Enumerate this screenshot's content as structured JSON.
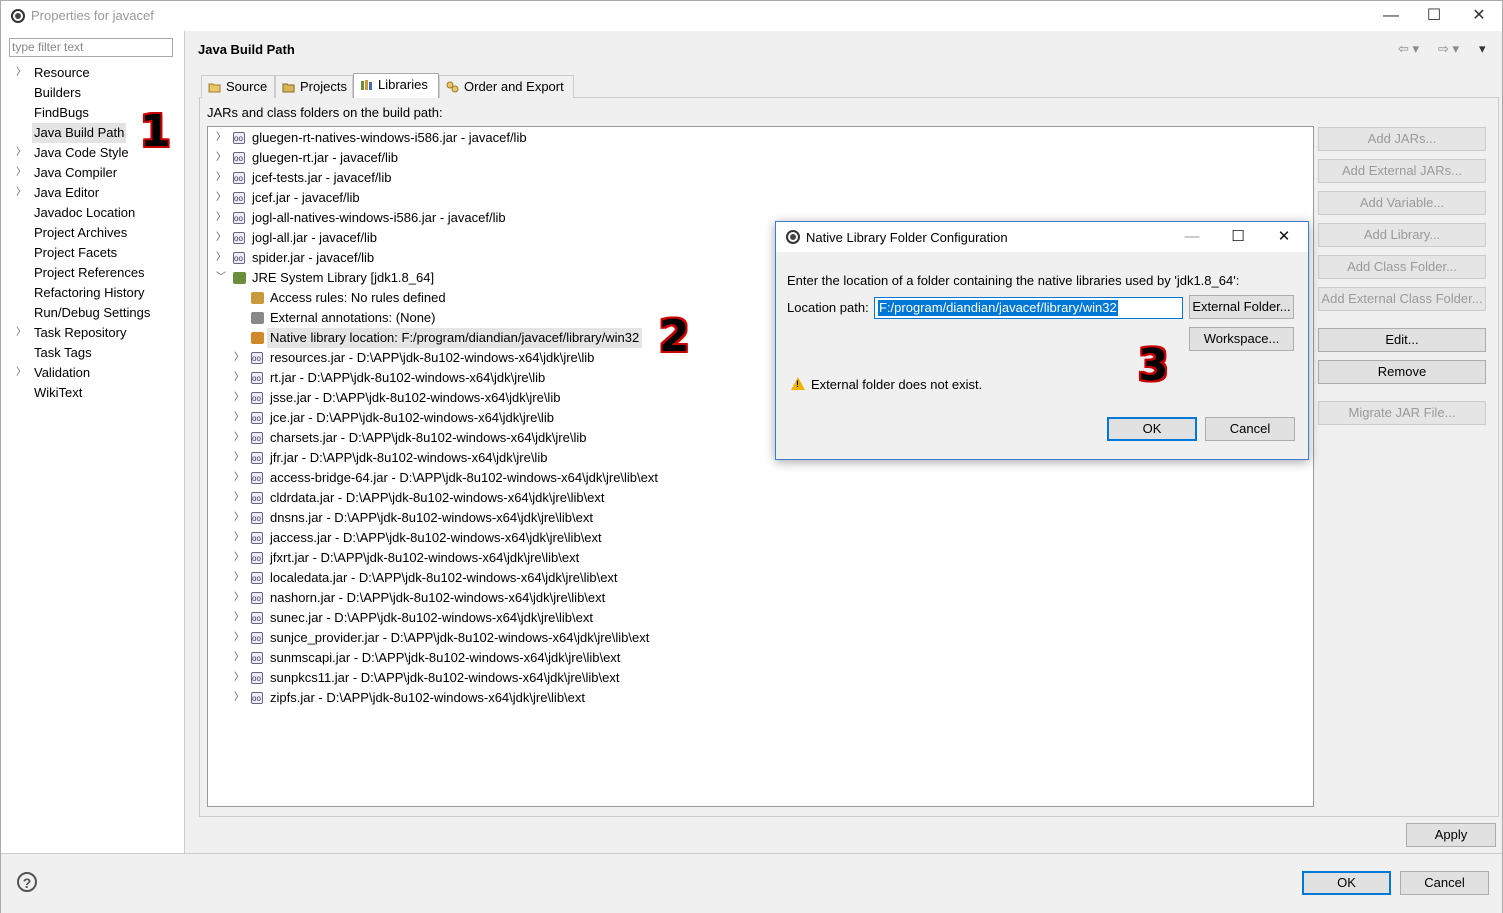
{
  "window": {
    "title": "Properties for javacef",
    "controls": [
      "—",
      "☐",
      "✕"
    ]
  },
  "filter": {
    "placeholder": "type filter text"
  },
  "nav": {
    "items": [
      {
        "label": "Resource",
        "expandable": true
      },
      {
        "label": "Builders",
        "expandable": false
      },
      {
        "label": "FindBugs",
        "expandable": false
      },
      {
        "label": "Java Build Path",
        "expandable": false,
        "selected": true
      },
      {
        "label": "Java Code Style",
        "expandable": true
      },
      {
        "label": "Java Compiler",
        "expandable": true
      },
      {
        "label": "Java Editor",
        "expandable": true
      },
      {
        "label": "Javadoc Location",
        "expandable": false
      },
      {
        "label": "Project Archives",
        "expandable": false
      },
      {
        "label": "Project Facets",
        "expandable": false
      },
      {
        "label": "Project References",
        "expandable": false
      },
      {
        "label": "Refactoring History",
        "expandable": false
      },
      {
        "label": "Run/Debug Settings",
        "expandable": false
      },
      {
        "label": "Task Repository",
        "expandable": true
      },
      {
        "label": "Task Tags",
        "expandable": false
      },
      {
        "label": "Validation",
        "expandable": true
      },
      {
        "label": "WikiText",
        "expandable": false
      }
    ]
  },
  "page": {
    "title": "Java Build Path",
    "nav_icons": [
      "back-icon",
      "forward-icon",
      "menu-icon"
    ],
    "tabs": [
      {
        "label": "Source",
        "icon": "source-folder-icon"
      },
      {
        "label": "Projects",
        "icon": "projects-icon"
      },
      {
        "label": "Libraries",
        "icon": "libraries-icon",
        "active": true
      },
      {
        "label": "Order and Export",
        "icon": "order-export-icon"
      }
    ],
    "build_label": "JARs and class folders on the build path:"
  },
  "tree": {
    "rows": [
      {
        "text": "gluegen-rt-natives-windows-i586.jar - javacef/lib",
        "level": 0,
        "icon": "jar"
      },
      {
        "text": "gluegen-rt.jar - javacef/lib",
        "level": 0,
        "icon": "jar"
      },
      {
        "text": "jcef-tests.jar - javacef/lib",
        "level": 0,
        "icon": "jar"
      },
      {
        "text": "jcef.jar - javacef/lib",
        "level": 0,
        "icon": "jar"
      },
      {
        "text": "jogl-all-natives-windows-i586.jar - javacef/lib",
        "level": 0,
        "icon": "jar"
      },
      {
        "text": "jogl-all.jar - javacef/lib",
        "level": 0,
        "icon": "jar"
      },
      {
        "text": "spider.jar - javacef/lib",
        "level": 0,
        "icon": "jar"
      },
      {
        "text": "JRE System Library [jdk1.8_64]",
        "level": 0,
        "icon": "library",
        "expanded": true
      },
      {
        "text": "Access rules: No rules defined",
        "level": 1,
        "icon": "rules",
        "leaf": true
      },
      {
        "text": "External annotations: (None)",
        "level": 1,
        "icon": "annotations",
        "leaf": true
      },
      {
        "text": "Native library location: F:/program/diandian/javacef/library/win32",
        "level": 1,
        "icon": "native",
        "leaf": true,
        "selected": true
      },
      {
        "text": "resources.jar - D:\\APP\\jdk-8u102-windows-x64\\jdk\\jre\\lib",
        "level": 1,
        "icon": "jar"
      },
      {
        "text": "rt.jar - D:\\APP\\jdk-8u102-windows-x64\\jdk\\jre\\lib",
        "level": 1,
        "icon": "jar"
      },
      {
        "text": "jsse.jar - D:\\APP\\jdk-8u102-windows-x64\\jdk\\jre\\lib",
        "level": 1,
        "icon": "jar"
      },
      {
        "text": "jce.jar - D:\\APP\\jdk-8u102-windows-x64\\jdk\\jre\\lib",
        "level": 1,
        "icon": "jar"
      },
      {
        "text": "charsets.jar - D:\\APP\\jdk-8u102-windows-x64\\jdk\\jre\\lib",
        "level": 1,
        "icon": "jar"
      },
      {
        "text": "jfr.jar - D:\\APP\\jdk-8u102-windows-x64\\jdk\\jre\\lib",
        "level": 1,
        "icon": "jar"
      },
      {
        "text": "access-bridge-64.jar - D:\\APP\\jdk-8u102-windows-x64\\jdk\\jre\\lib\\ext",
        "level": 1,
        "icon": "jar"
      },
      {
        "text": "cldrdata.jar - D:\\APP\\jdk-8u102-windows-x64\\jdk\\jre\\lib\\ext",
        "level": 1,
        "icon": "jar"
      },
      {
        "text": "dnsns.jar - D:\\APP\\jdk-8u102-windows-x64\\jdk\\jre\\lib\\ext",
        "level": 1,
        "icon": "jar"
      },
      {
        "text": "jaccess.jar - D:\\APP\\jdk-8u102-windows-x64\\jdk\\jre\\lib\\ext",
        "level": 1,
        "icon": "jar"
      },
      {
        "text": "jfxrt.jar - D:\\APP\\jdk-8u102-windows-x64\\jdk\\jre\\lib\\ext",
        "level": 1,
        "icon": "jar"
      },
      {
        "text": "localedata.jar - D:\\APP\\jdk-8u102-windows-x64\\jdk\\jre\\lib\\ext",
        "level": 1,
        "icon": "jar"
      },
      {
        "text": "nashorn.jar - D:\\APP\\jdk-8u102-windows-x64\\jdk\\jre\\lib\\ext",
        "level": 1,
        "icon": "jar"
      },
      {
        "text": "sunec.jar - D:\\APP\\jdk-8u102-windows-x64\\jdk\\jre\\lib\\ext",
        "level": 1,
        "icon": "jar"
      },
      {
        "text": "sunjce_provider.jar - D:\\APP\\jdk-8u102-windows-x64\\jdk\\jre\\lib\\ext",
        "level": 1,
        "icon": "jar"
      },
      {
        "text": "sunmscapi.jar - D:\\APP\\jdk-8u102-windows-x64\\jdk\\jre\\lib\\ext",
        "level": 1,
        "icon": "jar"
      },
      {
        "text": "sunpkcs11.jar - D:\\APP\\jdk-8u102-windows-x64\\jdk\\jre\\lib\\ext",
        "level": 1,
        "icon": "jar"
      },
      {
        "text": "zipfs.jar - D:\\APP\\jdk-8u102-windows-x64\\jdk\\jre\\lib\\ext",
        "level": 1,
        "icon": "jar"
      }
    ]
  },
  "side_buttons": [
    {
      "label": "Add JARs...",
      "enabled": false
    },
    {
      "label": "Add External JARs...",
      "enabled": false
    },
    {
      "label": "Add Variable...",
      "enabled": false
    },
    {
      "label": "Add Library...",
      "enabled": false
    },
    {
      "label": "Add Class Folder...",
      "enabled": false
    },
    {
      "label": "Add External Class Folder...",
      "enabled": false
    },
    {
      "label": "Edit...",
      "enabled": true
    },
    {
      "label": "Remove",
      "enabled": true
    },
    {
      "label": "Migrate JAR File...",
      "enabled": false
    }
  ],
  "apply_label": "Apply",
  "footer": {
    "help": "?",
    "ok": "OK",
    "cancel": "Cancel"
  },
  "dialog": {
    "title": "Native Library Folder Configuration",
    "controls": [
      "—",
      "☐",
      "✕"
    ],
    "message": "Enter the location of a folder containing the native libraries used by 'jdk1.8_64':",
    "location_label": "Location path:",
    "location_value": "F:/program/diandian/javacef/library/win32",
    "external_folder": "External Folder...",
    "workspace": "Workspace...",
    "warning": "External folder does not exist.",
    "ok": "OK",
    "cancel": "Cancel"
  },
  "annotations": [
    "1",
    "2",
    "3"
  ],
  "colors": {
    "accent": "#0078d7",
    "annotation_outline": "#cc0000",
    "warning": "#f0b400"
  }
}
